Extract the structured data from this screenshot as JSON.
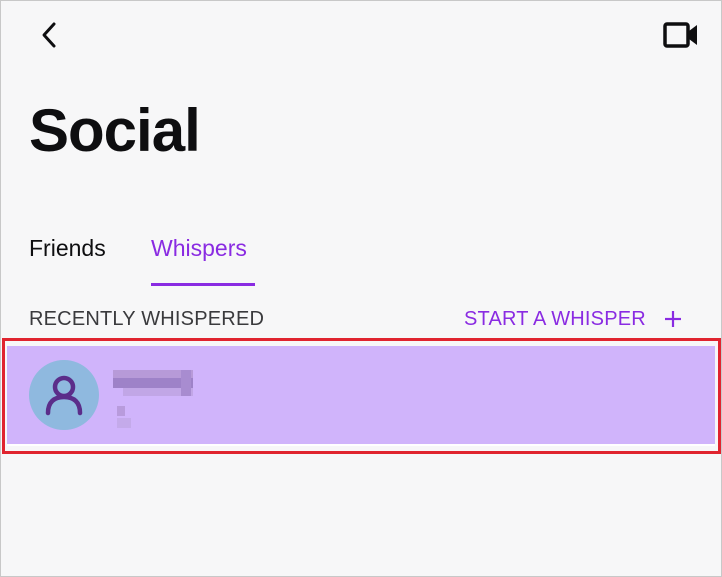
{
  "header": {
    "back_icon": "chevron-left-icon",
    "camera_icon": "video-camera-icon"
  },
  "page": {
    "title": "Social"
  },
  "tabs": [
    {
      "label": "Friends",
      "active": false
    },
    {
      "label": "Whispers",
      "active": true
    }
  ],
  "section": {
    "label": "RECENTLY WHISPERED",
    "action_label": "START A WHISPER",
    "action_icon": "plus-icon"
  },
  "conversations": [
    {
      "avatar_icon": "user-icon",
      "name": "",
      "preview": ""
    }
  ],
  "colors": {
    "accent": "#8a2be2",
    "row_highlight": "#d0b4fb",
    "avatar_bg": "#8fb9df",
    "avatar_icon": "#5b2d8a",
    "annotation_border": "#e0242f"
  }
}
